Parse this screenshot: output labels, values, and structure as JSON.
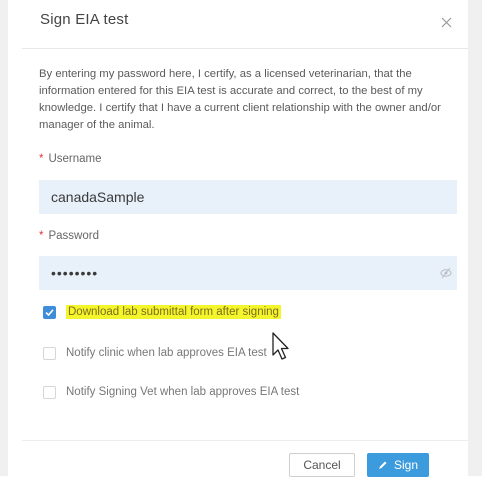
{
  "dialog": {
    "title": "Sign EIA test",
    "intro": "By entering my password here, I certify, as a licensed veterinarian, that the information entered for this EIA test is accurate and correct, to the best of my knowledge. I certify that I have a current client relationship with the owner and/or manager of the animal."
  },
  "form": {
    "username": {
      "label": "Username",
      "required_marker": "*",
      "value": "canadaSample"
    },
    "password": {
      "label": "Password",
      "required_marker": "*",
      "value": "••••••••"
    }
  },
  "options": [
    {
      "label": "Download lab submittal form after signing",
      "checked": true,
      "highlighted": true
    },
    {
      "label": "Notify clinic when lab approves EIA test",
      "checked": false
    },
    {
      "label": "Notify Signing Vet when lab approves EIA test",
      "checked": false
    }
  ],
  "footer": {
    "cancel_label": "Cancel",
    "sign_label": "Sign"
  },
  "icons": {
    "close": "close-icon",
    "eye": "eye-icon",
    "check": "check-icon",
    "pencil": "pencil-icon",
    "cursor": "cursor-icon"
  },
  "colors": {
    "accent": "#3c9bdc",
    "input_bg": "#e8f0fa",
    "required": "#e0393a",
    "highlight": "#f5f52c"
  }
}
